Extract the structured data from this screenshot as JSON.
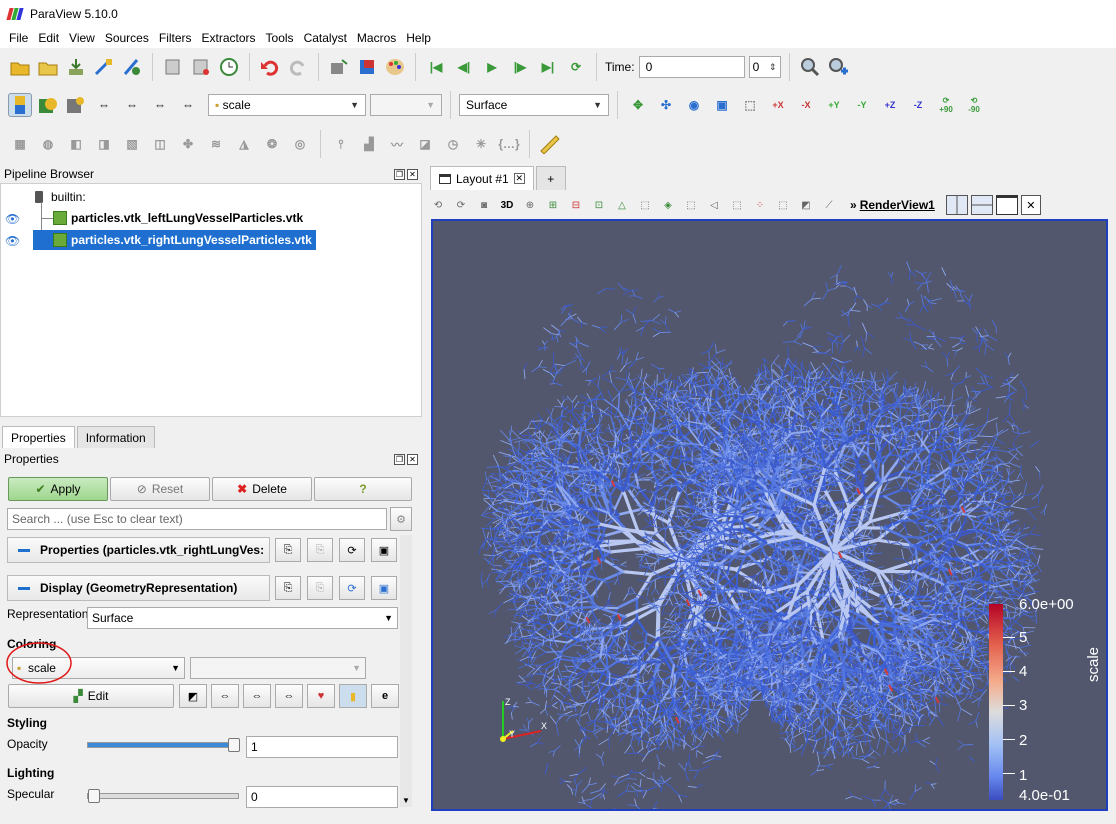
{
  "app": {
    "title": "ParaView 5.10.0"
  },
  "menu": [
    "File",
    "Edit",
    "View",
    "Sources",
    "Filters",
    "Extractors",
    "Tools",
    "Catalyst",
    "Macros",
    "Help"
  ],
  "toolbar": {
    "time_label": "Time:",
    "time_value": "0",
    "time_index": "0",
    "color_array": "scale",
    "representation": "Surface",
    "rotate_labels": [
      "+90",
      "-90"
    ]
  },
  "pipeline": {
    "title": "Pipeline Browser",
    "root": "builtin:",
    "items": [
      {
        "label": "particles.vtk_leftLungVesselParticles.vtk",
        "selected": false
      },
      {
        "label": "particles.vtk_rightLungVesselParticles.vtk",
        "selected": true
      }
    ]
  },
  "tabs": {
    "properties": "Properties",
    "information": "Information"
  },
  "properties": {
    "title": "Properties",
    "apply": "Apply",
    "reset": "Reset",
    "delete": "Delete",
    "help": "?",
    "search_placeholder": "Search ... (use Esc to clear text)",
    "section_properties": "Properties (particles.vtk_rightLungVes:",
    "section_display": "Display (GeometryRepresentation)",
    "representation_label": "Representation",
    "representation_value": "Surface",
    "coloring_label": "Coloring",
    "coloring_value": "scale",
    "edit_label": "Edit",
    "styling_label": "Styling",
    "opacity_label": "Opacity",
    "opacity_value": "1",
    "opacity_level": 1.0,
    "lighting_label": "Lighting",
    "specular_label": "Specular",
    "specular_value": "0",
    "specular_level": 0.0
  },
  "layout": {
    "tab_label": "Layout #1",
    "add_tab": "+",
    "view_name": "RenderView1",
    "view_3d": "3D"
  },
  "colorbar": {
    "title": "scale",
    "max_label": "6.0e+00",
    "min_label": "4.0e-01",
    "ticks": [
      "5",
      "4",
      "3",
      "2",
      "1"
    ]
  },
  "axes": {
    "x": "X",
    "y": "Y",
    "z": "Z"
  },
  "colors": {
    "accent": "#1e6fd0",
    "background": "#52576e",
    "vessel": "#4a6cd8"
  }
}
